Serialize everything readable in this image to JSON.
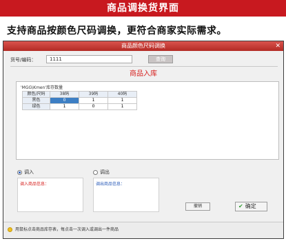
{
  "banner": {
    "title": "商品调换货界面"
  },
  "subtitle": "支持商品按颜色尺码调换，更符合商家实际需求。",
  "dialog": {
    "title": "商品颜色尺码调换",
    "close": "✕",
    "code_label": "货号/编码：",
    "code_value": "1111",
    "query_button": "查询",
    "section_title": "商品入库",
    "grid_caption": "'MGG\\Kmen'库存数量",
    "table": {
      "header": [
        "颜色/尺码",
        "38码",
        "39码",
        "40码"
      ],
      "rows": [
        {
          "color": "黑色",
          "values": [
            "0",
            "1",
            "1"
          ]
        },
        {
          "color": "绿色",
          "values": [
            "1",
            "0",
            "1"
          ]
        }
      ]
    },
    "radio_in": "调入",
    "radio_out": "调出",
    "in_info_label": "调入商品信息：",
    "out_info_label": "调出商品信息：",
    "cancel_button": "撤销",
    "confirm_button": "确定",
    "status_text": "用鼠标点击商品库存表，每点击一次调入或调出一件商品",
    "colors": {
      "accent_red": "#c8191f",
      "selected_cell": "#3d7fc4",
      "in_label": "#d6201e",
      "out_label": "#2a5bb8"
    }
  }
}
